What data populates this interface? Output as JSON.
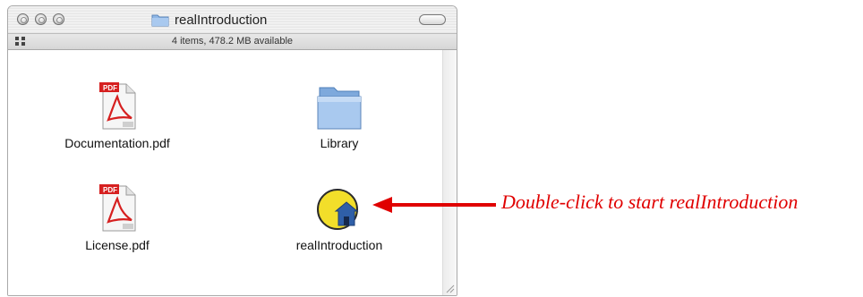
{
  "window": {
    "title": "realIntroduction",
    "status": "4 items, 478.2 MB available"
  },
  "items": [
    {
      "label": "Documentation.pdf",
      "icon": "pdf-document-icon"
    },
    {
      "label": "Library",
      "icon": "folder-icon"
    },
    {
      "label": "License.pdf",
      "icon": "pdf-document-icon"
    },
    {
      "label": "realIntroduction",
      "icon": "application-icon"
    }
  ],
  "annotation": {
    "text": "Double-click to start realIntroduction",
    "color": "#e00000"
  },
  "colors": {
    "pdf_red": "#d62020",
    "folder_blue": "#8fb7e6",
    "app_yellow": "#f2de2a"
  }
}
